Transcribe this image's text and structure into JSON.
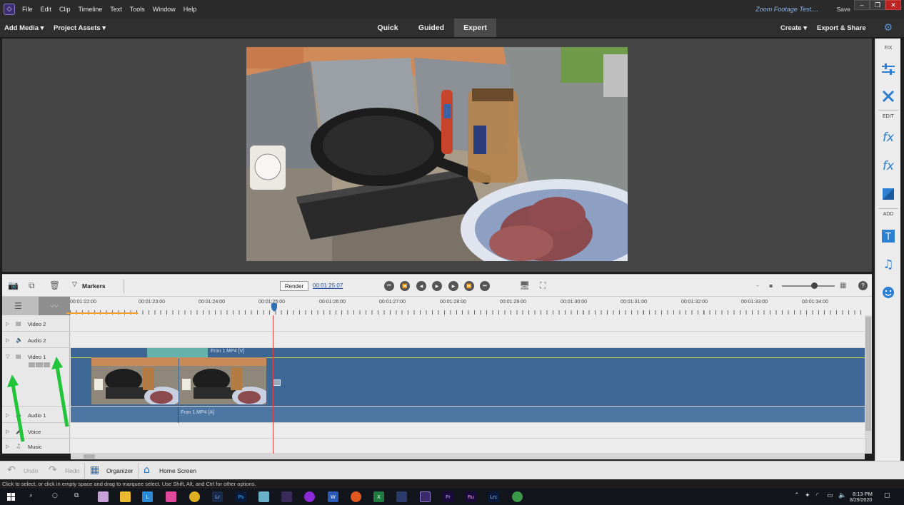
{
  "menubar": {
    "items": [
      "File",
      "Edit",
      "Clip",
      "Timeline",
      "Text",
      "Tools",
      "Window",
      "Help"
    ],
    "doc_title": "Zoom Footage Test....",
    "save_label": "Save"
  },
  "modebar": {
    "add_media": "Add Media ▾",
    "project_assets": "Project Assets ▾",
    "tabs": [
      "Quick",
      "Guided",
      "Expert"
    ],
    "active_tab": "Expert",
    "create": "Create ▾",
    "export_share": "Export & Share"
  },
  "right_panel": {
    "fix_label": "FIX",
    "edit_label": "EDIT",
    "add_label": "ADD"
  },
  "timeline_toolbar": {
    "markers_label": "Markers",
    "render_label": "Render",
    "timecode": "00:01:25:07"
  },
  "ruler": {
    "ticks": [
      "00:01:22:00",
      "00:01:23:00",
      "00:01:24:00",
      "00:01:25:00",
      "00:01:26:00",
      "00:01:27:00",
      "00:01:28:00",
      "00:01:29:00",
      "00:01:30:00",
      "00:01:31:00",
      "00:01:32:00",
      "00:01:33:00",
      "00:01:34:00"
    ]
  },
  "tracks": {
    "video2": "Video 2",
    "audio2": "Audio 2",
    "video1": "Video 1",
    "audio1": "Audio 1",
    "voice": "Voice",
    "music": "Music",
    "clip_video_label": "Fron 1.MP4 [V]",
    "clip_audio_label": "Fron 1.MP4 [A]"
  },
  "bottombar": {
    "undo": "Undo",
    "redo": "Redo",
    "organizer": "Organizer",
    "home_screen": "Home Screen"
  },
  "status": {
    "text": "Click to select, or click in empty space and drag to marquee select. Use Shift, Alt, and Ctrl for other options."
  },
  "taskbar": {
    "time": "8:13 PM",
    "date": "8/29/2020"
  },
  "colors": {
    "accent_blue": "#2d7fd1",
    "video_track": "#3e6896",
    "playhead": "#e04040",
    "annotation_arrow": "#22c43a"
  }
}
